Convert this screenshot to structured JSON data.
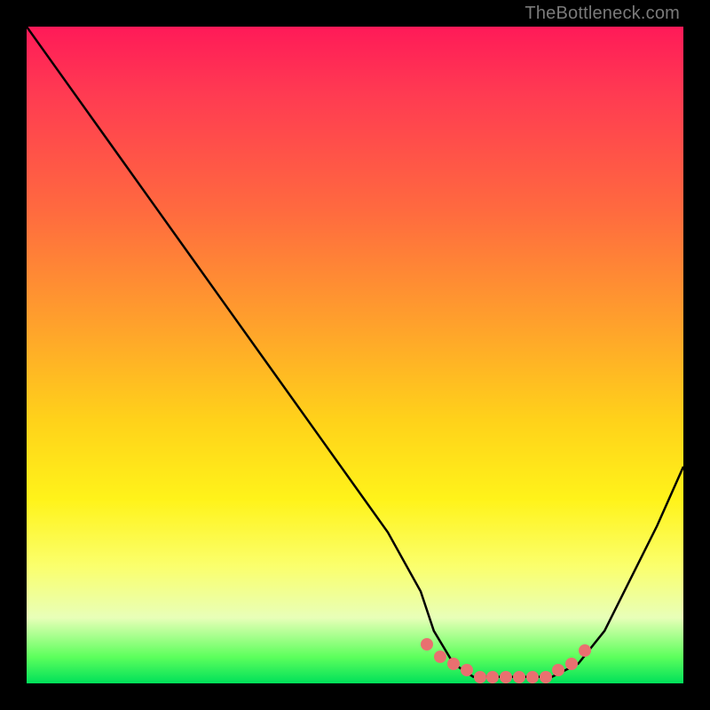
{
  "watermark": "TheBottleneck.com",
  "chart_data": {
    "type": "line",
    "title": "",
    "xlabel": "",
    "ylabel": "",
    "xlim": [
      0,
      100
    ],
    "ylim": [
      0,
      100
    ],
    "background_gradient": {
      "top": "#ff1a58",
      "bottom": "#00e05a",
      "meaning": "red=bottleneck, green=optimal"
    },
    "series": [
      {
        "name": "bottleneck-curve",
        "x": [
          0,
          5,
          10,
          15,
          20,
          25,
          30,
          35,
          40,
          45,
          50,
          55,
          60,
          62,
          65,
          68,
          72,
          76,
          80,
          84,
          88,
          92,
          96,
          100
        ],
        "y": [
          100,
          93,
          86,
          79,
          72,
          65,
          58,
          51,
          44,
          37,
          30,
          23,
          14,
          8,
          3,
          1,
          1,
          1,
          1,
          3,
          8,
          16,
          24,
          33
        ]
      }
    ],
    "highlight_points": {
      "name": "optimal-range-dots",
      "color": "#e97070",
      "x": [
        61,
        63,
        65,
        67,
        69,
        71,
        73,
        75,
        77,
        79,
        81,
        83,
        85
      ],
      "y": [
        6,
        4,
        3,
        2,
        1,
        1,
        1,
        1,
        1,
        1,
        2,
        3,
        5
      ]
    }
  }
}
